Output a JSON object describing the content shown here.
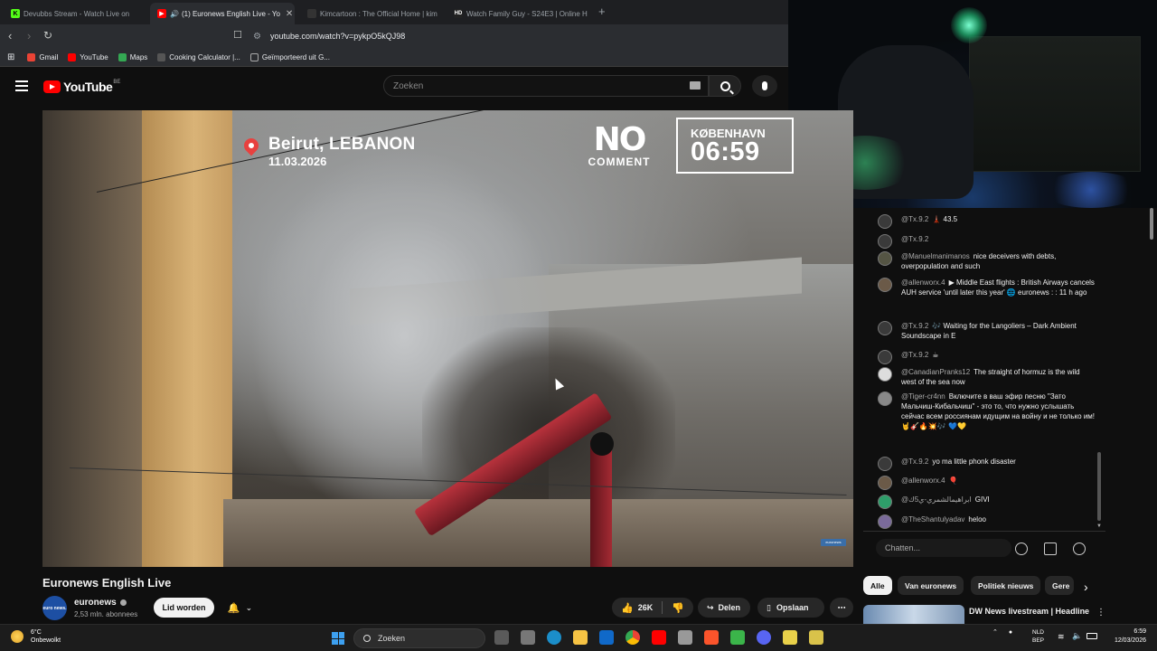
{
  "browser": {
    "tabs": [
      {
        "title": "Devubbs Stream - Watch Live on",
        "favicon": "K",
        "color": "#53fc18"
      },
      {
        "title": "(1) Euronews English Live - Yo",
        "favicon": "▶",
        "color": "#ff0000",
        "active": true
      },
      {
        "title": "Kimcartoon : The Official Home | kim",
        "favicon": "",
        "color": "#333333"
      },
      {
        "title": "Watch Family Guy - S24E3 | Online H",
        "favicon": "HD",
        "color": "#222222"
      }
    ],
    "url": "youtube.com/watch?v=pykpO5kQJ98",
    "bookmarks": [
      {
        "label": "Gmail",
        "color": "#ea4335"
      },
      {
        "label": "YouTube",
        "color": "#ff0000"
      },
      {
        "label": "Maps",
        "color": "#34a853"
      },
      {
        "label": "Cooking Calculator |...",
        "color": "#555555"
      },
      {
        "label": "Geïmporteerd uit G...",
        "color": "#aaaaaa"
      }
    ]
  },
  "youtube": {
    "logo": "YouTube",
    "region": "BE",
    "search_placeholder": "Zoeken"
  },
  "video": {
    "overlay": {
      "city": "Beirut, LEBANON",
      "date": "11.03.2026",
      "brand_top": "NO",
      "brand_bottom": "COMMENT",
      "clock_city": "KØBENHAVN",
      "clock_time": "06:59",
      "corner_logo": "euronews"
    },
    "title": "Euronews English Live",
    "channel": {
      "avatar_text": "euro news.",
      "name": "euronews",
      "subscribers": "2,53 mln. abonnees"
    },
    "join_label": "Lid worden",
    "like_count": "26K",
    "share_label": "Delen",
    "save_label": "Opslaan"
  },
  "chat": {
    "messages": [
      {
        "author": "@Tx.9.2",
        "text": "🗼 43.5"
      },
      {
        "author": "@Tx.9.2",
        "text": ""
      },
      {
        "author": "@Manuelmanimanos",
        "text": "nice deceivers with debts, overpopulation and such"
      },
      {
        "author": "@allenworx.4",
        "text": "▶ Middle East flights : British Airways cancels AUH service 'until later this year' 🌐 euronews : : 11 h ago"
      },
      {
        "author": "@Tx.9.2",
        "text": "🎶 Waiting for the Langoliers – Dark Ambient Soundscape in E"
      },
      {
        "author": "@Tx.9.2",
        "text": "☕"
      },
      {
        "author": "@CanadianPranks12",
        "text": "The straight of hormuz is the wild west of the sea now"
      },
      {
        "author": "@Tiger-cr4nn",
        "text": "Включите в ваш эфир песню \"Зато Мальчиш-Кибальчиш\" - это то, что нужно услышать сейчас всем россиянам идущим на войну и не только им! 🤘🎸🔥💥🎶 💙💛"
      },
      {
        "author": "@Tx.9.2",
        "text": "yo ma little phonk disaster"
      },
      {
        "author": "@allenworx.4",
        "text": "🎈"
      },
      {
        "author": "@ابراهيمالشمري-ي5ك",
        "text": "GIVI"
      },
      {
        "author": "@TheShantulyadav",
        "text": "heloo"
      }
    ],
    "input_placeholder": "Chatten..."
  },
  "chips": [
    "Alle",
    "Van euronews",
    "Politiek nieuws",
    "Gere"
  ],
  "recommendation": {
    "title": "DW News livestream | Headline"
  },
  "taskbar": {
    "weather_temp": "6°C",
    "weather_desc": "Onbewolkt",
    "search_label": "Zoeken",
    "lang_top": "NLD",
    "lang_bottom": "BEP",
    "time": "6:59",
    "date": "12/03/2026"
  }
}
